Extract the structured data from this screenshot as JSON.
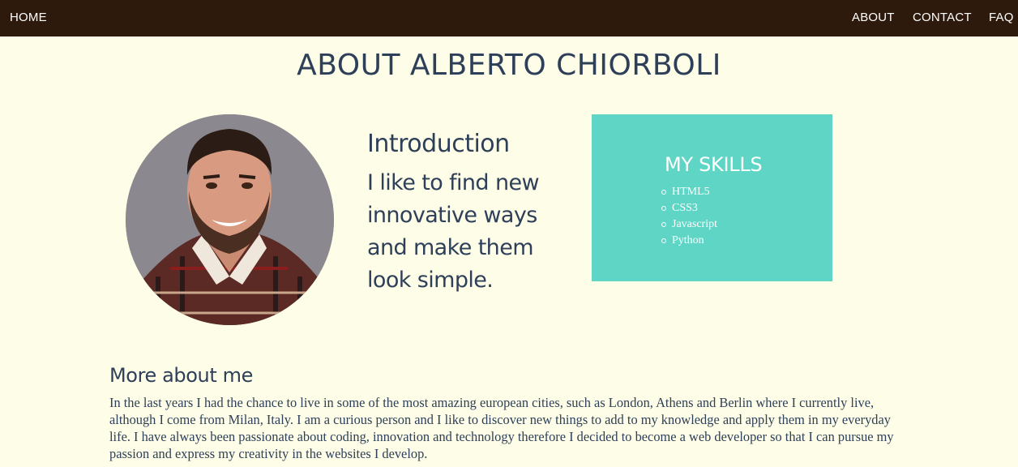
{
  "nav": {
    "home": "HOME",
    "about": "ABOUT",
    "contact": "CONTACT",
    "faq": "FAQ"
  },
  "page": {
    "title": "ABOUT ALBERTO CHIORBOLI"
  },
  "intro": {
    "heading": "Introduction",
    "text": "I like to find new innovative ways and make them look simple."
  },
  "skills": {
    "title": "MY SKILLS",
    "items": [
      "HTML5",
      "CSS3",
      "Javascript",
      "Python"
    ]
  },
  "more": {
    "heading": "More about me",
    "text": "In the last years I had the chance to live in some of the most amazing european cities, such as London, Athens and Berlin where I currently live, although I come from Milan, Italy. I am a curious person and I like to discover new things to add to my knowledge and apply them in my everyday life. I have always been passionate about coding, innovation and technology therefore I decided to become a web developer so that I can pursue my passion and express my creativity in the websites I develop."
  },
  "colors": {
    "nav_background": "#2e1a0c",
    "page_background": "#fefde7",
    "heading_text": "#2e4059",
    "skills_background": "#5ed5c5"
  },
  "icons": {
    "avatar": "profile-photo"
  }
}
